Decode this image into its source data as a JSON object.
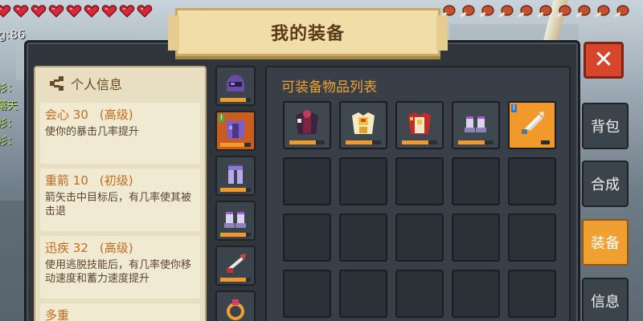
{
  "hud": {
    "level_text": "g:86",
    "hearts": 9,
    "hunger": 10,
    "chat": [
      "衫：",
      "落天",
      "衫：",
      "衫："
    ]
  },
  "window": {
    "title": "我的装备",
    "close_label": "✕"
  },
  "stats": {
    "header": "个人信息",
    "items": [
      {
        "name": "会心",
        "value": "30",
        "grade": "(高级)",
        "desc": "使你的暴击几率提升"
      },
      {
        "name": "重箭",
        "value": "10",
        "grade": "(初级)",
        "desc": "箭矢击中目标后，有几率使其被击退"
      },
      {
        "name": "迅疾",
        "value": "32",
        "grade": "(高级)",
        "desc": "使用逃脱技能后，有几率使你移动速度和蓄力速度提升"
      },
      {
        "name": "多重",
        "value": "",
        "grade": "",
        "desc": ""
      }
    ]
  },
  "equipped": [
    {
      "icon": "helmet-icon",
      "tag": "",
      "durability": 0.85,
      "selected": false
    },
    {
      "icon": "armor-icon",
      "tag": "I",
      "durability": 0.8,
      "selected": true
    },
    {
      "icon": "leggings-icon",
      "tag": "",
      "durability": 0.85,
      "selected": false
    },
    {
      "icon": "boots-icon",
      "tag": "",
      "durability": 0.85,
      "selected": false
    },
    {
      "icon": "arrow-icon",
      "tag": "",
      "durability": 0.85,
      "selected": false
    },
    {
      "icon": "ring-icon",
      "tag": "",
      "durability": 0.8,
      "selected": false
    }
  ],
  "inventory": {
    "title": "可装备物品列表",
    "items": [
      {
        "icon": "dark-armor-icon",
        "tag": "",
        "durability": 0.75
      },
      {
        "icon": "gold-armor-icon",
        "tag": "",
        "durability": 0.75
      },
      {
        "icon": "red-armor-icon",
        "tag": "",
        "durability": 0.75
      },
      {
        "icon": "boots-icon",
        "tag": "",
        "durability": 0.75
      },
      {
        "icon": "arrows-icon",
        "tag": "I",
        "durability": 0.75
      }
    ],
    "total_slots": 20
  },
  "tabs": [
    {
      "label": "背包",
      "active": false
    },
    {
      "label": "合成",
      "active": false
    },
    {
      "label": "装备",
      "active": true
    },
    {
      "label": "信息",
      "active": false
    }
  ],
  "colors": {
    "accent": "#f0a030",
    "stat_name": "#c86a1b",
    "close": "#d7462b"
  }
}
